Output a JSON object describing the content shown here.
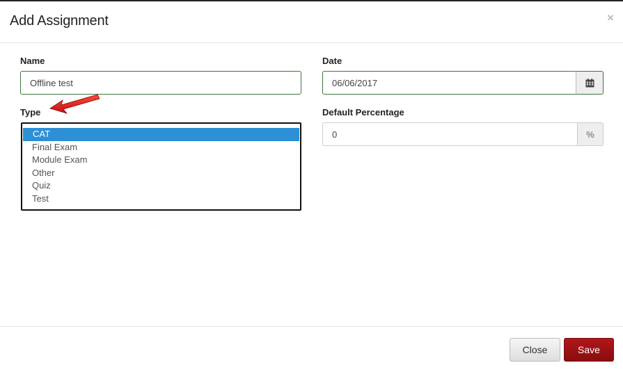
{
  "modal": {
    "title": "Add Assignment",
    "close_glyph": "×"
  },
  "form": {
    "name_label": "Name",
    "name_value": "Offline test",
    "date_label": "Date",
    "date_value": "06/06/2017",
    "type_label": "Type",
    "type_options": [
      "CAT",
      "Final Exam",
      "Module Exam",
      "Other",
      "Quiz",
      "Test"
    ],
    "type_selected": "CAT",
    "percentage_label": "Default Percentage",
    "percentage_value": "0",
    "percentage_addon": "%"
  },
  "footer": {
    "close_label": "Close",
    "save_label": "Save"
  },
  "colors": {
    "accent_selected": "#2d8fd5",
    "save_button": "#9b1115",
    "valid_border": "#3c763d",
    "annotation_arrow": "#e32222"
  },
  "icons": {
    "calendar": "calendar-icon",
    "annotation": "red-arrow-annotation"
  }
}
